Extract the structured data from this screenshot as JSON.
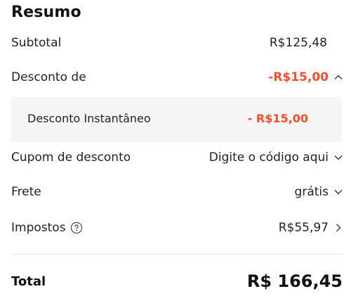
{
  "summary": {
    "title": "Resumo",
    "subtotal": {
      "label": "Subtotal",
      "value": "R$125,48"
    },
    "discount": {
      "label": "Desconto de",
      "value": "-R$15,00",
      "expanded": true,
      "items": [
        {
          "label": "Desconto Instantâneo",
          "value": "- R$15,00"
        }
      ]
    },
    "coupon": {
      "label": "Cupom de desconto",
      "value": "Digite o código aqui"
    },
    "shipping": {
      "label": "Frete",
      "value": "grátis"
    },
    "taxes": {
      "label": "Impostos",
      "value": "R$55,97",
      "help_icon": "question-circle-icon"
    },
    "total": {
      "label": "Total",
      "value": "R$ 166,45"
    }
  },
  "colors": {
    "accent_discount": "#ff4d2e",
    "text": "#222222",
    "panel_bg": "#f5f5f5",
    "divider": "#e6e6e6"
  }
}
